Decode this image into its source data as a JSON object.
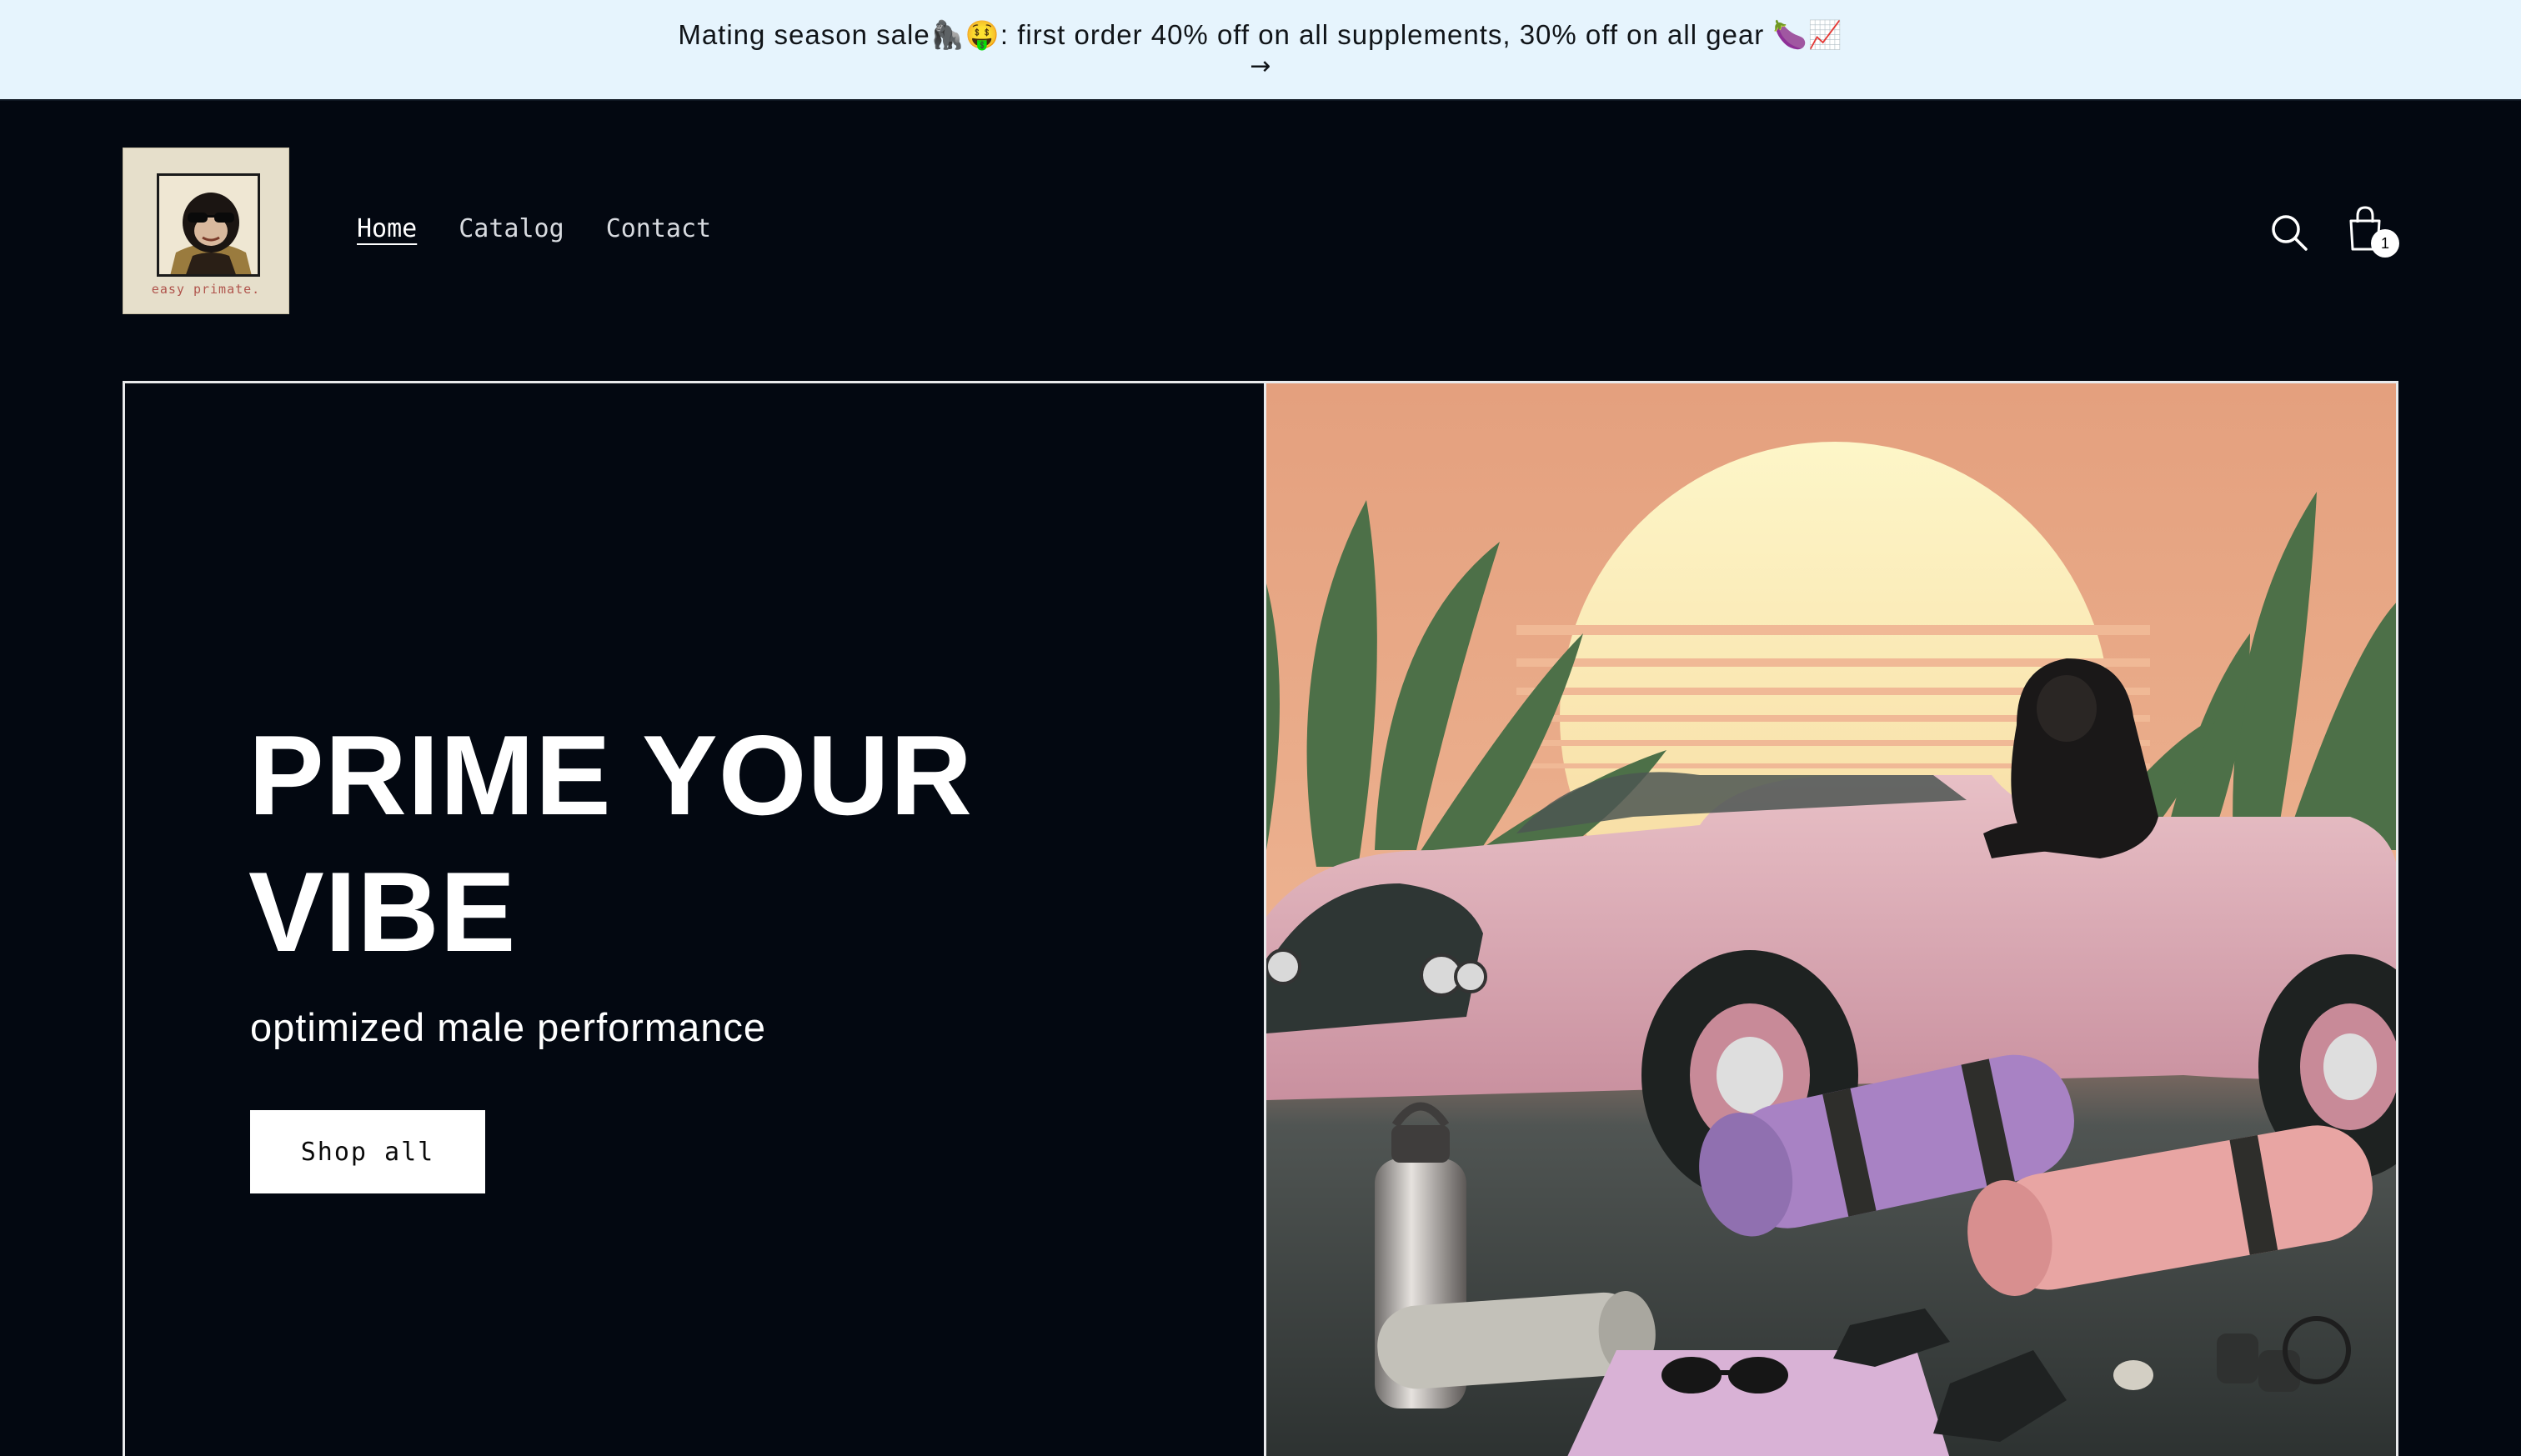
{
  "announcement": {
    "text": "Mating season sale🦍🤑: first order 40% off on all supplements, 30% off on all gear 🍆📈",
    "arrow": "→"
  },
  "brand": {
    "logo_text": "easy primate."
  },
  "nav": {
    "items": [
      {
        "label": "Home",
        "active": true
      },
      {
        "label": "Catalog",
        "active": false
      },
      {
        "label": "Contact",
        "active": false
      }
    ]
  },
  "header_icons": {
    "search": "search-icon",
    "cart": "cart-icon",
    "cart_count": "1"
  },
  "hero": {
    "title": "PRIME YOUR VIBE",
    "subtitle": "optimized male performance",
    "cta_label": "Shop all"
  },
  "colors": {
    "announcement_bg": "#e6f4fd",
    "page_bg": "#030811",
    "button_bg": "#ffffff",
    "car_pink": "#d9a7b2",
    "sun_yellow": "#fbeeb6"
  }
}
